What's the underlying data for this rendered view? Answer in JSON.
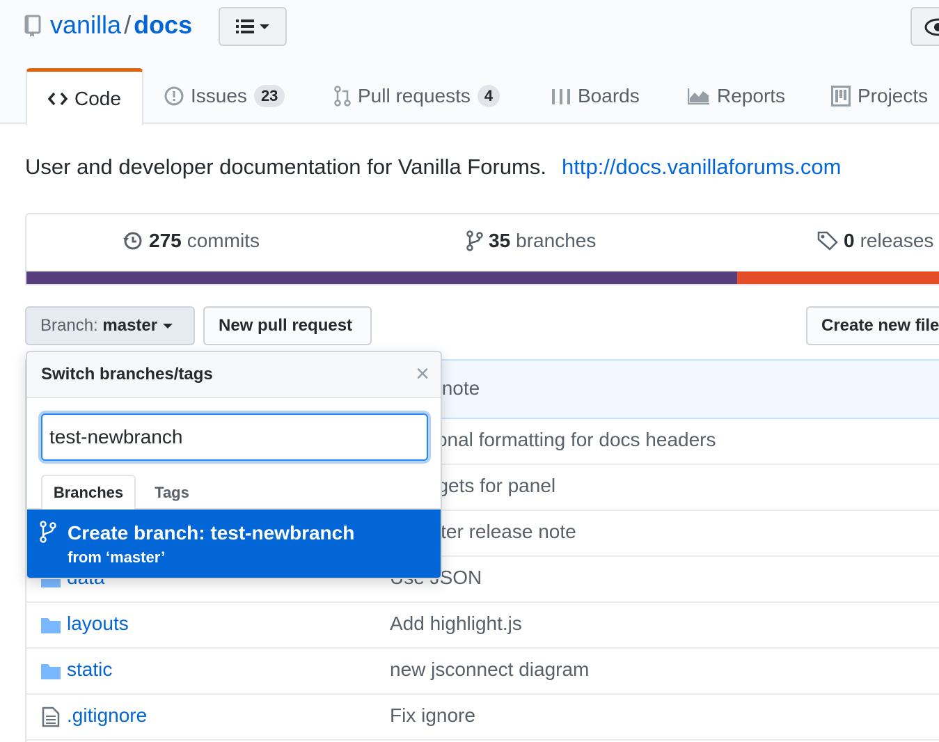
{
  "repo": {
    "owner": "vanilla",
    "separator": "/",
    "name": "docs"
  },
  "tabs": {
    "code": "Code",
    "issues": "Issues",
    "issues_count": "23",
    "pulls": "Pull requests",
    "pulls_count": "4",
    "boards": "Boards",
    "reports": "Reports",
    "projects": "Projects"
  },
  "description": {
    "text": "User and developer documentation for Vanilla Forums.",
    "link": "http://docs.vanillaforums.com"
  },
  "summary": {
    "commits_count": "275",
    "commits_label": "commits",
    "branches_count": "35",
    "branches_label": "branches",
    "releases_count": "0",
    "releases_label": "releases"
  },
  "toolbar": {
    "branch_prefix": "Branch:",
    "branch_name": "master",
    "new_pr": "New pull request",
    "create_file": "Create new file"
  },
  "files": {
    "latest_commit_msg": "lease note",
    "rows": [
      {
        "name": "",
        "message": "onditional formatting for docs headers",
        "icon": "folder-icon"
      },
      {
        "name": "",
        "message": "ck targets for panel",
        "icon": "folder-icon"
      },
      {
        "name": "",
        "message": "te winter release note",
        "icon": "folder-icon"
      },
      {
        "name": "data",
        "message": "Use JSON",
        "icon": "folder-icon"
      },
      {
        "name": "layouts",
        "message": "Add highlight.js",
        "icon": "folder-icon"
      },
      {
        "name": "static",
        "message": "new jsconnect diagram",
        "icon": "folder-icon"
      },
      {
        "name": ".gitignore",
        "message": "Fix ignore",
        "icon": "file-icon"
      }
    ]
  },
  "dropdown": {
    "title": "Switch branches/tags",
    "close": "×",
    "filter_value": "test-newbranch",
    "tab_branches": "Branches",
    "tab_tags": "Tags",
    "create_title": "Create branch: test-newbranch",
    "create_sub": "from ‘master’"
  },
  "colors": {
    "link": "#0366d6",
    "selected_tab_accent": "#e36209",
    "lang_css": "#563d7c",
    "lang_html": "#e34c26"
  },
  "language_bar": {
    "segments": [
      {
        "color": "#563d7c",
        "fraction": 0.77
      },
      {
        "color": "#e34c26",
        "fraction": 0.23
      }
    ]
  }
}
